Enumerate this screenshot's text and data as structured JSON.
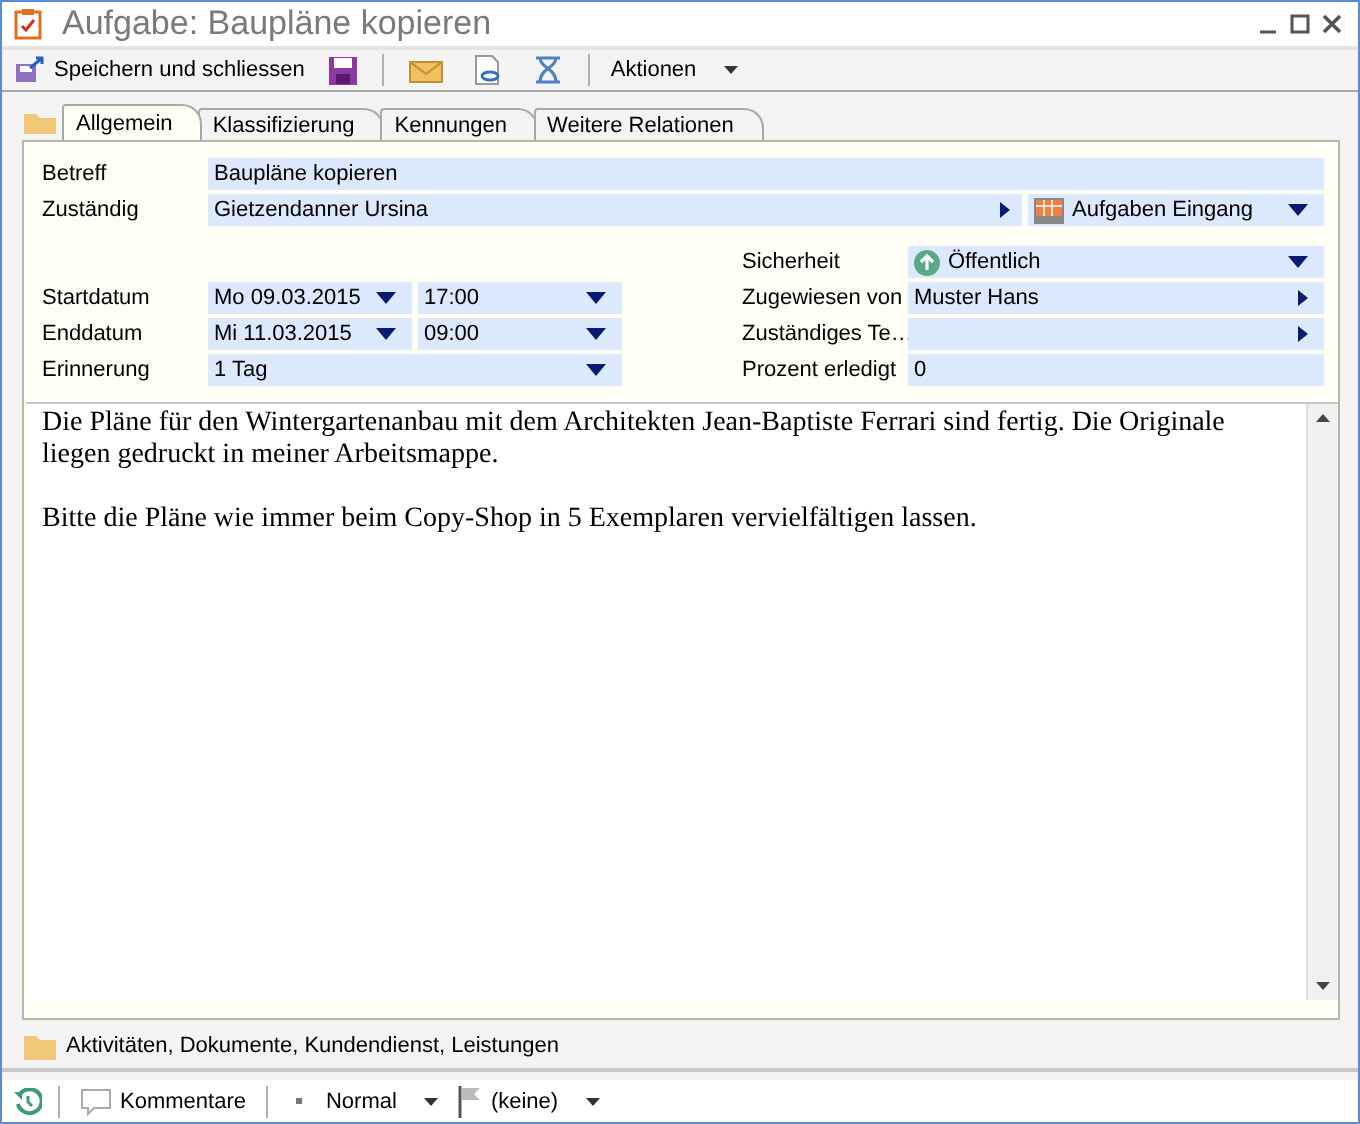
{
  "window": {
    "title": "Aufgabe: Baupläne kopieren"
  },
  "toolbar": {
    "save_close": "Speichern und schliessen",
    "actions": "Aktionen"
  },
  "tabs": [
    {
      "label": "Allgemein",
      "selected": true
    },
    {
      "label": "Klassifizierung",
      "selected": false
    },
    {
      "label": "Kennungen",
      "selected": false
    },
    {
      "label": "Weitere Relationen",
      "selected": false
    }
  ],
  "subject": {
    "label": "Betreff",
    "value": "Baupläne kopieren"
  },
  "responsible": {
    "label": "Zuständig",
    "value": "Gietzendanner Ursina",
    "folder": "Aufgaben Eingang"
  },
  "dates": [
    {
      "label": "Startdatum",
      "date": "Mo 09.03.2015",
      "time": "17:00"
    },
    {
      "label": "Enddatum",
      "date": "Mi 11.03.2015",
      "time": "09:00"
    }
  ],
  "reminder": {
    "label": "Erinnerung",
    "value": "1 Tag"
  },
  "right_fields": [
    {
      "label": "Sicherheit",
      "value": "Öffentlich",
      "kind": "security"
    },
    {
      "label": "Zugewiesen von",
      "value": "Muster Hans",
      "kind": "link"
    },
    {
      "label": "Zuständiges Te…",
      "kind": "link"
    },
    {
      "label": "Prozent erledigt",
      "value": "0",
      "kind": "text"
    }
  ],
  "description": [
    "Die Pläne für den Wintergartenanbau mit dem Architekten Jean-Baptiste Ferrari sind fertig. Die Originale liegen gedruckt in meiner Arbeitsmappe.",
    "Bitte die Pläne wie immer beim Copy-Shop in 5 Exemplaren vervielfältigen lassen."
  ],
  "related": "Aktivitäten, Dokumente, Kundendienst, Leistungen",
  "status_bar": {
    "comments": "Kommentare",
    "priority": "Normal",
    "flag": "(keine)"
  }
}
